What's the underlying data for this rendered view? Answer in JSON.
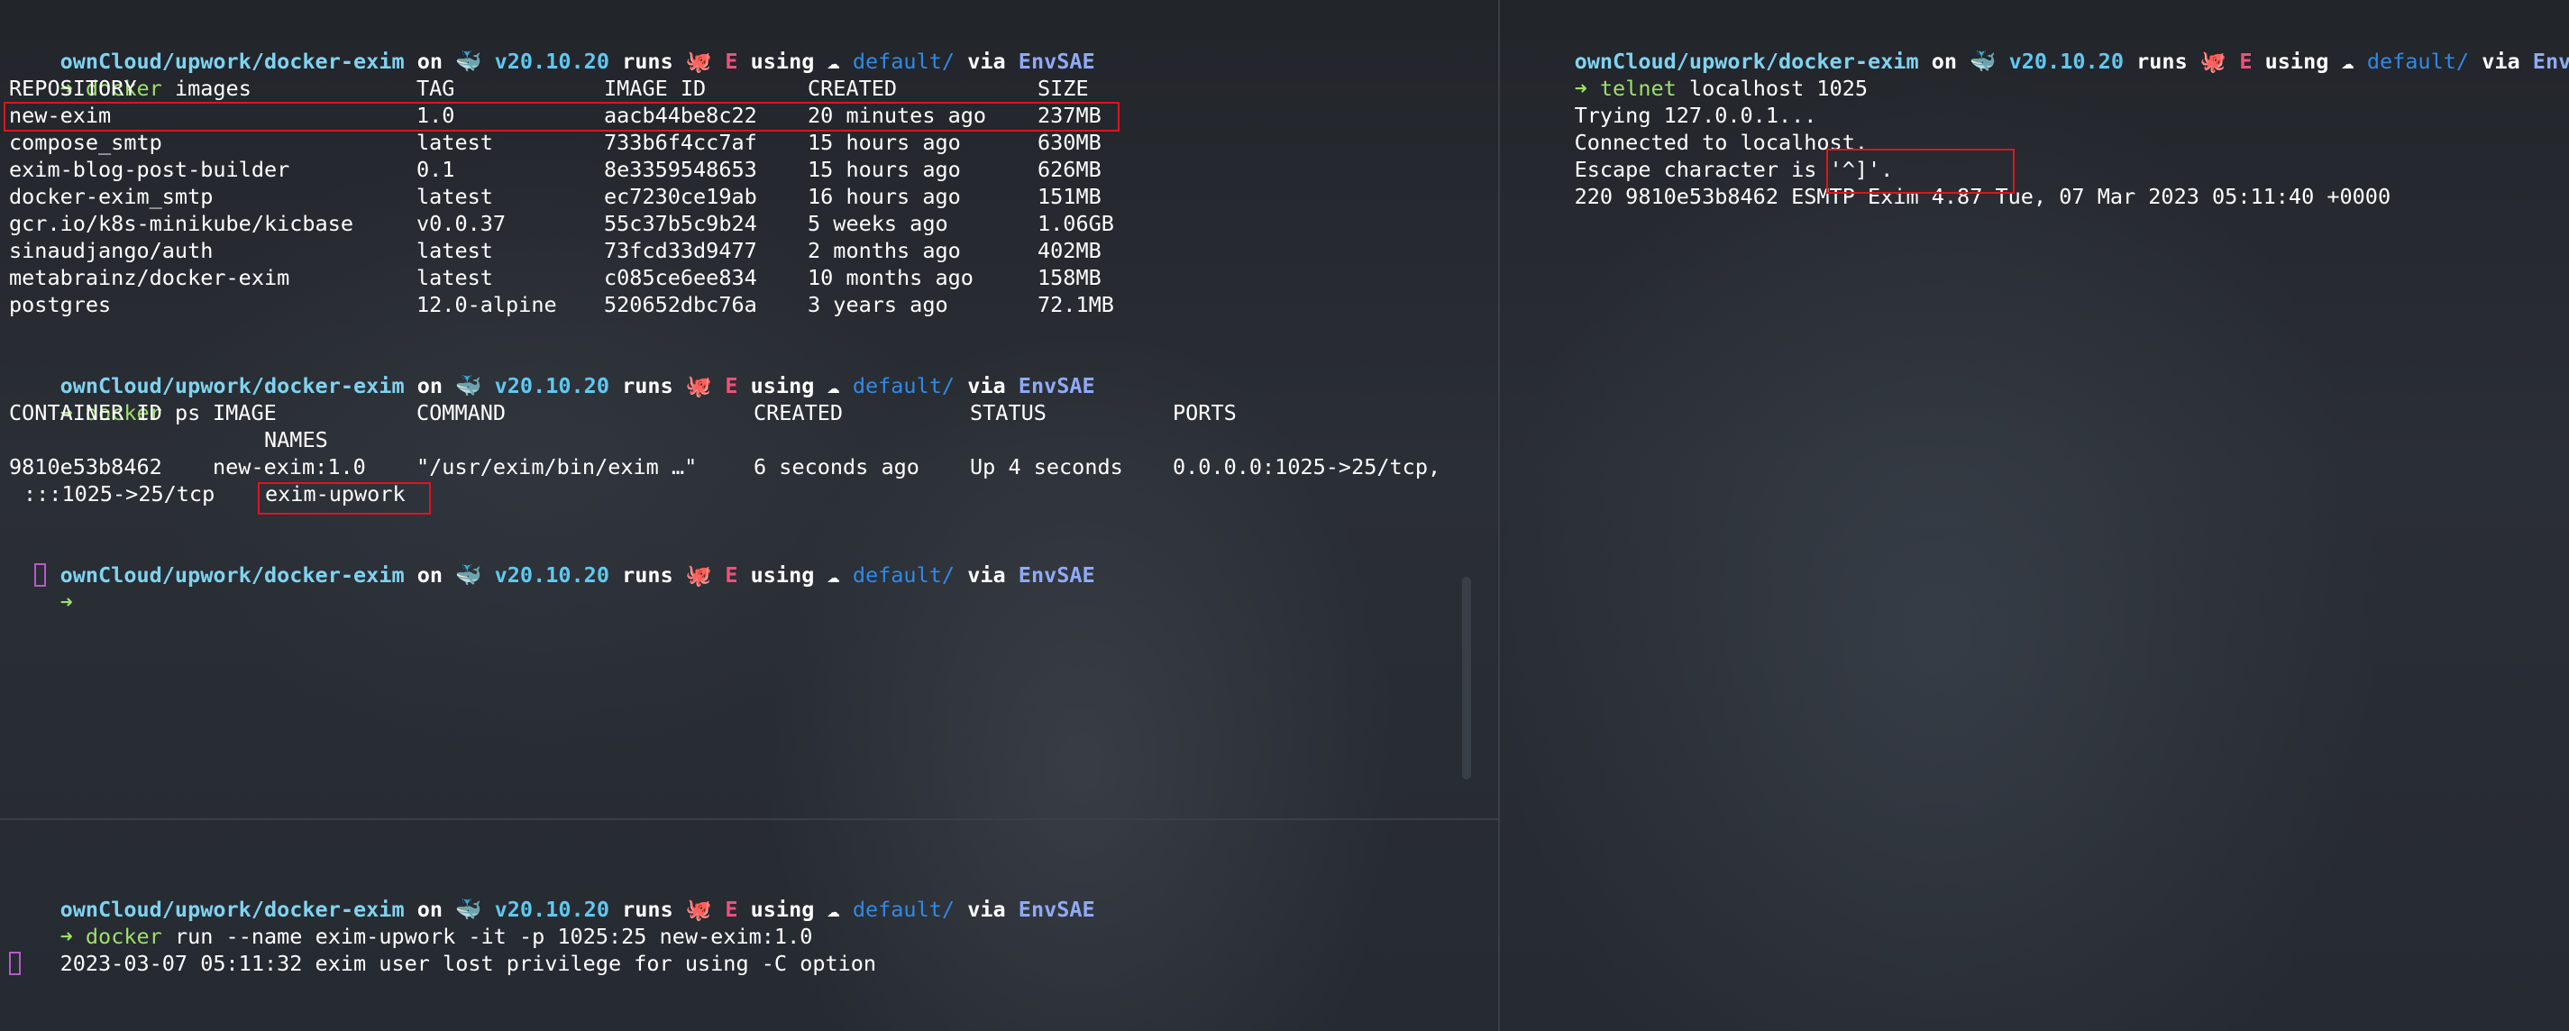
{
  "prompt": {
    "path": "ownCloud/upwork/docker-exim",
    "on": "on",
    "docker_icon": "🐳",
    "docker_version": "v20.10.20",
    "runs": "runs",
    "helm_icon": "🐙",
    "helm_context": "E",
    "using": "using",
    "cloud_icon": "☁",
    "gcloud_context": "default/",
    "via": "via",
    "env": "EnvSAE",
    "arrow": "➜"
  },
  "top_left": {
    "cmd1": {
      "name": "docker",
      "args": "images"
    },
    "images_headers": [
      "REPOSITORY",
      "TAG",
      "IMAGE ID",
      "CREATED",
      "SIZE"
    ],
    "images_rows": [
      [
        "new-exim",
        "1.0",
        "aacb44be8c22",
        "20 minutes ago",
        "237MB"
      ],
      [
        "compose_smtp",
        "latest",
        "733b6f4cc7af",
        "15 hours ago",
        "630MB"
      ],
      [
        "exim-blog-post-builder",
        "0.1",
        "8e3359548653",
        "15 hours ago",
        "626MB"
      ],
      [
        "docker-exim_smtp",
        "latest",
        "ec7230ce19ab",
        "16 hours ago",
        "151MB"
      ],
      [
        "gcr.io/k8s-minikube/kicbase",
        "v0.0.37",
        "55c37b5c9b24",
        "5 weeks ago",
        "1.06GB"
      ],
      [
        "sinaudjango/auth",
        "latest",
        "73fcd33d9477",
        "2 months ago",
        "402MB"
      ],
      [
        "metabrainz/docker-exim",
        "latest",
        "c085ce6ee834",
        "10 months ago",
        "158MB"
      ],
      [
        "postgres",
        "12.0-alpine",
        "520652dbc76a",
        "3 years ago",
        "72.1MB"
      ]
    ],
    "cmd2": {
      "name": "docker",
      "args": "ps"
    },
    "ps_headers": [
      "CONTAINER ID",
      "IMAGE",
      "COMMAND",
      "CREATED",
      "STATUS",
      "PORTS"
    ],
    "ps_names_header": "NAMES",
    "ps_row": {
      "container_id": "9810e53b8462",
      "image": "new-exim:1.0",
      "command": "\"/usr/exim/bin/exim …\"",
      "created": "6 seconds ago",
      "status": "Up 4 seconds",
      "ports": "0.0.0.0:1025->25/tcp,",
      "ports_cont": ":::1025->25/tcp",
      "names": "exim-upwork"
    }
  },
  "bottom_left": {
    "cmd": {
      "name": "docker",
      "args": "run --name exim-upwork -it -p 1025:25 new-exim:1.0"
    },
    "output": "2023-03-07 05:11:32 exim user lost privilege for using -C option"
  },
  "right": {
    "cmd": {
      "name": "telnet",
      "args": "localhost 1025"
    },
    "output_lines": [
      "Trying 127.0.0.1...",
      "Connected to localhost.",
      "Escape character is '^]'."
    ],
    "banner_prefix": "220 9810e53b8462 ESMTP",
    "banner_highlight": "Exim 4.87 Tue",
    "banner_suffix": ", 07 Mar 2023 05:11:40 +0000"
  },
  "colors": {
    "highlight_box": "#e0141e",
    "path": "#7fd3f0",
    "arrow": "#9ee06a",
    "context_blue": "#2f8ae8",
    "env": "#8faaf5",
    "helm_red": "#f0507a"
  }
}
